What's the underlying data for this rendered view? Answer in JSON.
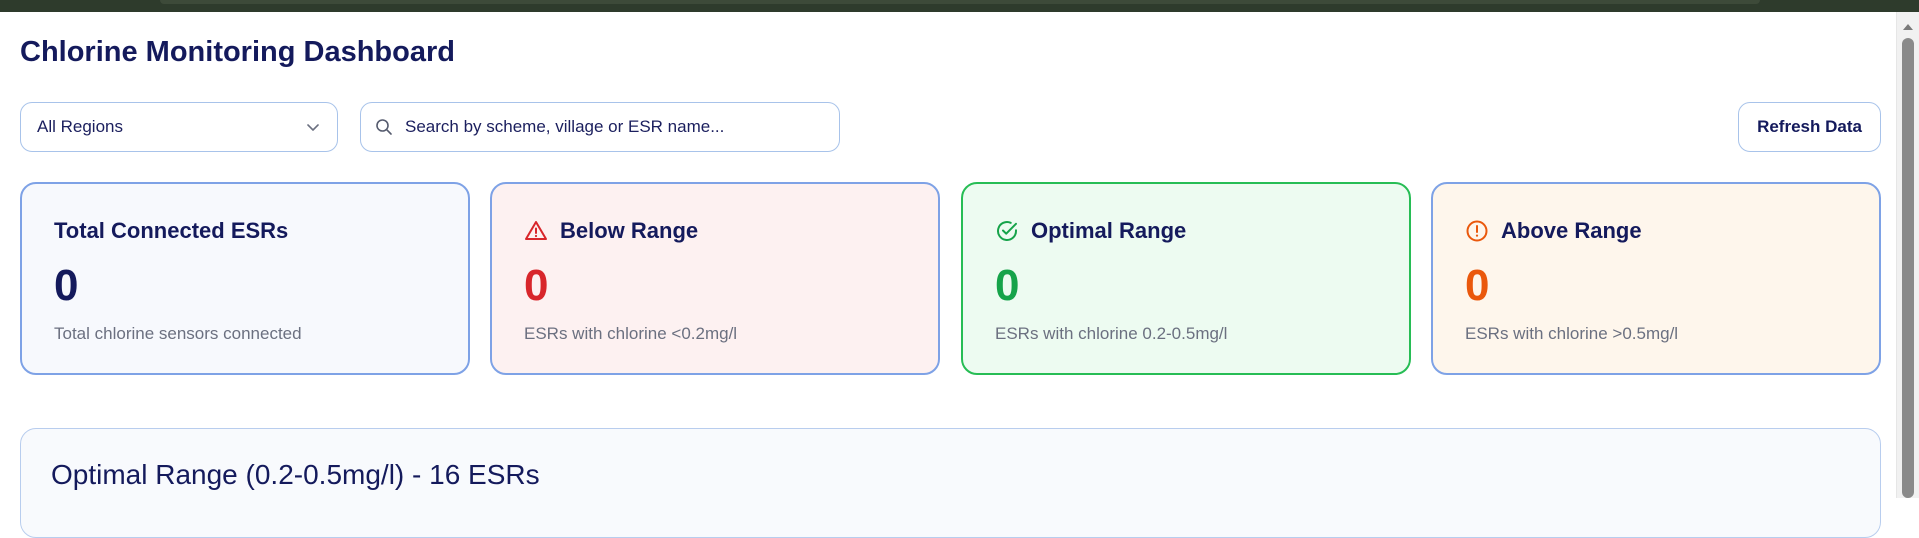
{
  "header": {
    "title": "Chlorine Monitoring Dashboard"
  },
  "filters": {
    "region_value": "All Regions",
    "search_placeholder": "Search by scheme, village or ESR name...",
    "search_value": "",
    "refresh_label": "Refresh Data"
  },
  "cards": [
    {
      "title": "Total Connected ESRs",
      "value": "0",
      "subtitle": "Total chlorine sensors connected",
      "icon": "none",
      "accent": "#141a5c"
    },
    {
      "title": "Below Range",
      "value": "0",
      "subtitle": "ESRs with chlorine <0.2mg/l",
      "icon": "warning-triangle-icon",
      "accent": "#d8262b"
    },
    {
      "title": "Optimal Range",
      "value": "0",
      "subtitle": "ESRs with chlorine 0.2-0.5mg/l",
      "icon": "check-circle-icon",
      "accent": "#16a34a"
    },
    {
      "title": "Above Range",
      "value": "0",
      "subtitle": "ESRs with chlorine >0.5mg/l",
      "icon": "alert-circle-icon",
      "accent": "#ea580c"
    }
  ],
  "section": {
    "title": "Optimal Range (0.2-0.5mg/l) - 16 ESRs"
  }
}
